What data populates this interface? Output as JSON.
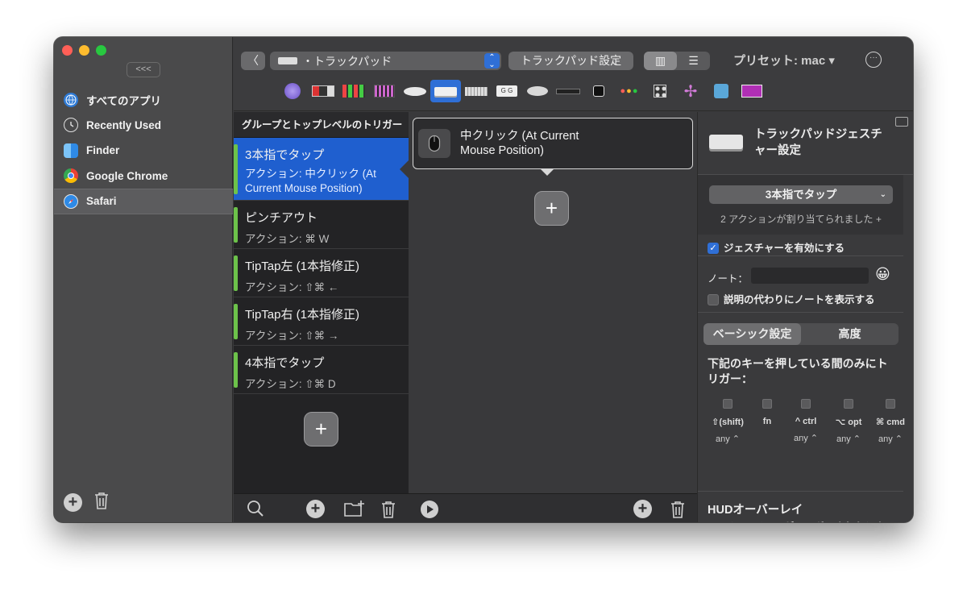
{
  "sidebar": {
    "collapse_label": "<<<",
    "apps": [
      {
        "label": "すべてのアプリ",
        "icon": "globe-icon",
        "selected": false
      },
      {
        "label": "Recently Used",
        "icon": "clock-icon",
        "selected": false
      },
      {
        "label": "Finder",
        "icon": "finder-icon",
        "selected": false
      },
      {
        "label": "Google Chrome",
        "icon": "chrome-icon",
        "selected": false
      },
      {
        "label": "Safari",
        "icon": "safari-icon",
        "selected": true
      }
    ],
    "add_label": "+"
  },
  "toolbar": {
    "back_label": "〈",
    "device_select": "・トラックパッド",
    "trackpad_settings_label": "トラックパッド設定",
    "preset_label": "プリセット: mac ▾",
    "more_label": "···",
    "devices": [
      "globe-device-icon",
      "touchbar-icon",
      "stream-deck-icon",
      "keypad-icon",
      "magic-mouse-icon",
      "trackpad-icon",
      "keyboard-icon",
      "key-sequence-icon",
      "normal-mouse-icon",
      "siri-remote-icon",
      "notch-icon",
      "window-buttons-icon",
      "midi-icon",
      "drawing-icon",
      "automation-icon",
      "other-device-icon"
    ],
    "active_device_index": 5
  },
  "groups": {
    "header": "グループとトップレベルのトリガー",
    "triggers": [
      {
        "title": "3本指でタップ",
        "action": "アクション: 中クリック (At Current Mouse Position)",
        "selected": true
      },
      {
        "title": "ピンチアウト",
        "action": "アクション: ⌘ W",
        "selected": false
      },
      {
        "title": "TipTap左 (1本指修正)",
        "action": "アクション: ⇧⌘ ←",
        "selected": false
      },
      {
        "title": "TipTap右 (1本指修正)",
        "action": "アクション: ⇧⌘ →",
        "selected": false
      },
      {
        "title": "4本指でタップ",
        "action": "アクション: ⇧⌘ D",
        "selected": false
      }
    ],
    "add_label": "+"
  },
  "actions": {
    "card_line1": "中クリック (At Current",
    "card_line2": "Mouse Position)",
    "add_label": "+"
  },
  "inspector": {
    "title": "トラックパッドジェスチャー設定",
    "trigger_select": "3本指でタップ",
    "assigned_text": "2 アクションが割り当てられました +",
    "enable_label": "ジェスチャーを有効にする",
    "note_label": "ノート：",
    "emoji": "😀",
    "show_note_label": "説明の代わりにノートを表示する",
    "tab_basic": "ベーシック設定",
    "tab_advanced": "高度",
    "modifier_heading": "下記のキーを押している間のみにトリガー：",
    "modifiers": [
      {
        "label": "⇧(shift)",
        "any": "any ⌃"
      },
      {
        "label": "fn",
        "any": ""
      },
      {
        "label": "^ ctrl",
        "any": "any ⌃"
      },
      {
        "label": "⌥ opt",
        "any": "any ⌃"
      },
      {
        "label": "⌘ cmd",
        "any": "any ⌃"
      }
    ],
    "hud_heading": "HUDオーバーレイ",
    "hud_label": "ジェスチャーがトリガーされたときに表示"
  }
}
